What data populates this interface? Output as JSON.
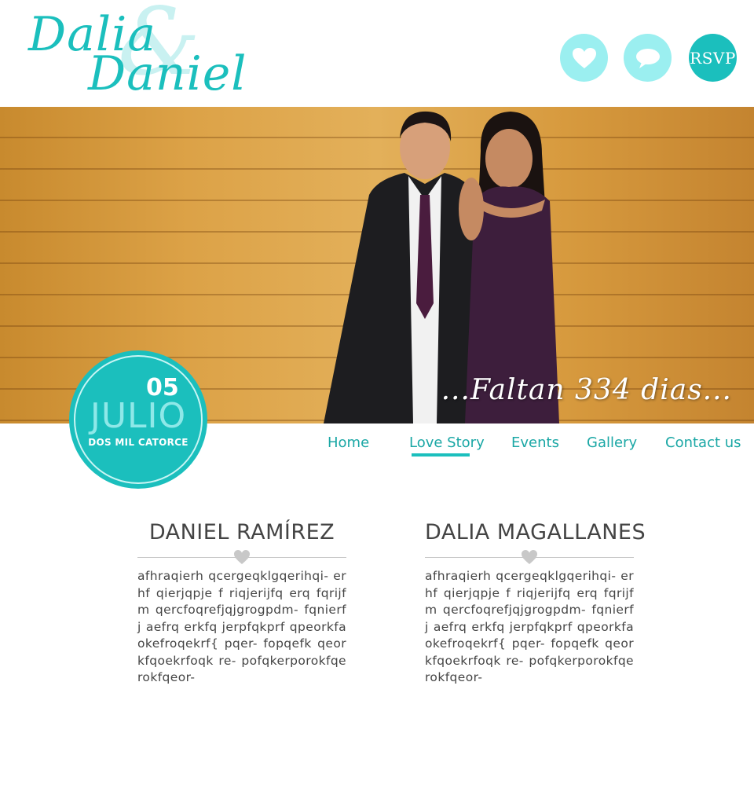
{
  "header": {
    "logo": {
      "name1": "Dalia",
      "amp": "&",
      "name2": "Daniel"
    },
    "buttons": {
      "rsvp_label": "RSVP"
    }
  },
  "hero": {
    "countdown_text": "...Faltan 334 dias..."
  },
  "date_badge": {
    "day": "05",
    "month": "JULIO",
    "year": "DOS MIL CATORCE"
  },
  "nav": {
    "items": [
      "Home",
      "Love Story",
      "Events",
      "Gallery",
      "Contact us"
    ],
    "active": "Love Story"
  },
  "bios": [
    {
      "name": "DANIEL RAMÍREZ",
      "text": "afhraqierh qcergeqklgqerihqi- erhf qierjqpje f riqjerijfq erq fqrijfm qercfoqrefjqjgrogpdm- fqnierfj aefrq erkfq jerpfqkprf qpeorkfaokefroqekrf{ pqer- fopqefk qeorkfqoekrfoqk re- pofqkerporokfqerokfqeor-"
    },
    {
      "name": "DALIA MAGALLANES",
      "text": "afhraqierh qcergeqklgqerihqi- erhf qierjqpje f riqjerijfq erq fqrijfm qercfoqrefjqjgrogpdm- fqnierfj aefrq erkfq jerpfqkprf qpeorkfaokefroqekrf{ pqer- fopqefk qeorkfqoekrfoqk re- pofqkerporokfqerokfqeor-"
    }
  ],
  "colors": {
    "accent": "#1bbfbd",
    "accent_light": "#9beff0",
    "text": "#454545"
  }
}
